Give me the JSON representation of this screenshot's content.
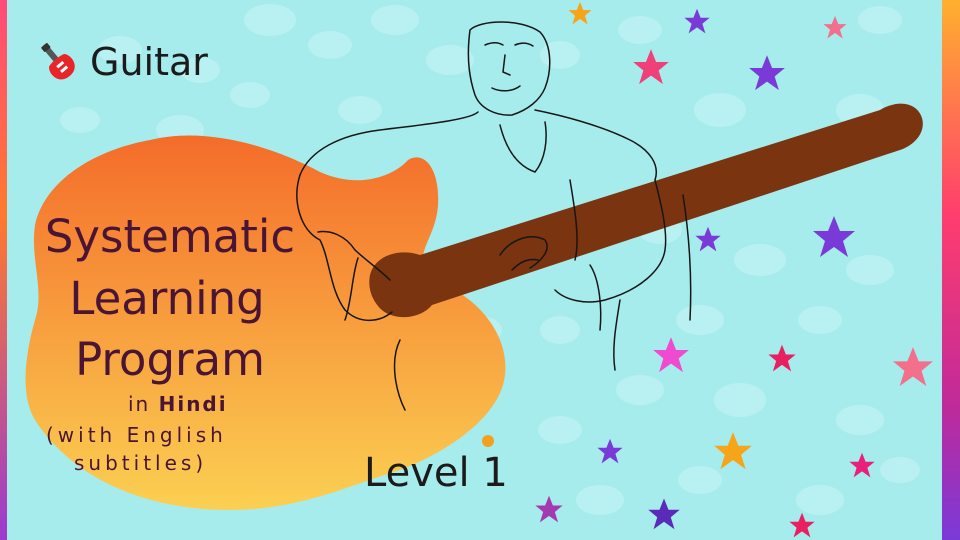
{
  "brand": {
    "icon": "electric-guitar-icon",
    "label": "Guitar"
  },
  "title_lines": [
    "Systematic",
    "Learning",
    "Program"
  ],
  "language": {
    "prefix": "in",
    "name": "Hindi"
  },
  "subtitle_lines": [
    "(with English",
    "subtitles)"
  ],
  "level": {
    "label": "Level",
    "number": "1"
  },
  "colors": {
    "background": "#a6ecec",
    "title_text": "#4a1535",
    "guitar_body_top": "#f46c2a",
    "guitar_body_bottom": "#fbd052",
    "guitar_neck": "#7a3410"
  }
}
